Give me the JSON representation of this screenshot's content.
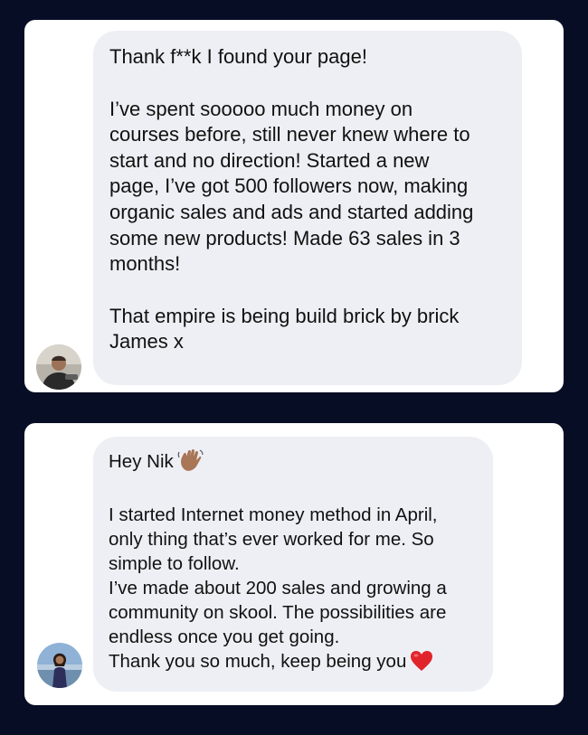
{
  "messages": [
    {
      "sender_avatar_icon": "man-avatar-icon",
      "lines": [
        "Thank f**k I found your page!",
        "",
        "I’ve spent sooooo much money on",
        "courses before, still never knew where to",
        "start and no direction! Started a new",
        "page, I’ve got 500 followers now, making",
        "organic sales and ads and started adding",
        "some new products! Made 63 sales in 3",
        "months!",
        "",
        "That empire is being build brick by brick",
        "James x"
      ]
    },
    {
      "sender_avatar_icon": "woman-avatar-icon",
      "greeting": "Hey Nik",
      "greeting_emoji_icon": "waving-hand-icon",
      "lines": [
        "I started Internet money method in April,",
        "only thing that’s ever worked for me. So",
        "simple to follow.",
        "I’ve made about 200 sales and growing a",
        "community on skool. The possibilities are",
        "endless once you get going."
      ],
      "closing": "Thank you so much, keep being you",
      "closing_emoji_icon": "red-heart-icon"
    }
  ],
  "colors": {
    "page_background": "#060d24",
    "card_background": "#ffffff",
    "bubble_background": "#eeeff4",
    "text": "#111111",
    "heart": "#e0242c"
  }
}
